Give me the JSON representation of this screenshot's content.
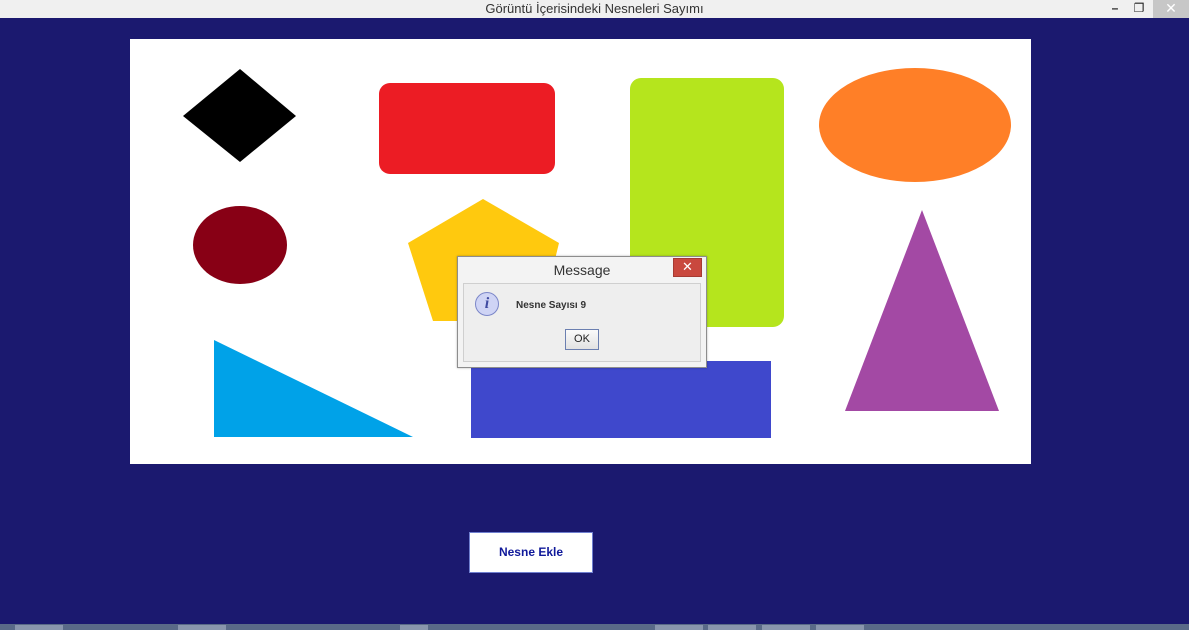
{
  "window": {
    "title": "Görüntü İçerisindeki Nesneleri Sayımı",
    "minimize_glyph": "–",
    "maximize_glyph": "❐",
    "close_glyph": "✕"
  },
  "canvas": {
    "shapes": [
      {
        "name": "black-diamond",
        "type": "diamond",
        "color": "#000000"
      },
      {
        "name": "red-rounded-rectangle",
        "type": "rounded-rectangle",
        "color": "#ec1c24"
      },
      {
        "name": "lime-rounded-rectangle",
        "type": "rounded-rectangle",
        "color": "#b5e51d"
      },
      {
        "name": "orange-ellipse",
        "type": "ellipse",
        "color": "#ff7f27"
      },
      {
        "name": "dark-red-ellipse",
        "type": "ellipse",
        "color": "#880015"
      },
      {
        "name": "yellow-pentagon",
        "type": "pentagon",
        "color": "#ffc90e"
      },
      {
        "name": "purple-triangle",
        "type": "triangle",
        "color": "#a349a4"
      },
      {
        "name": "blue-right-triangle",
        "type": "triangle",
        "color": "#00a2e8"
      },
      {
        "name": "indigo-rectangle",
        "type": "rectangle",
        "color": "#3f48cc"
      }
    ]
  },
  "dialog": {
    "title": "Message",
    "close_glyph": "✕",
    "icon": "info-icon",
    "icon_glyph": "i",
    "message": "Nesne Sayısı 9",
    "ok_label": "OK"
  },
  "main": {
    "add_button_label": "Nesne Ekle"
  }
}
